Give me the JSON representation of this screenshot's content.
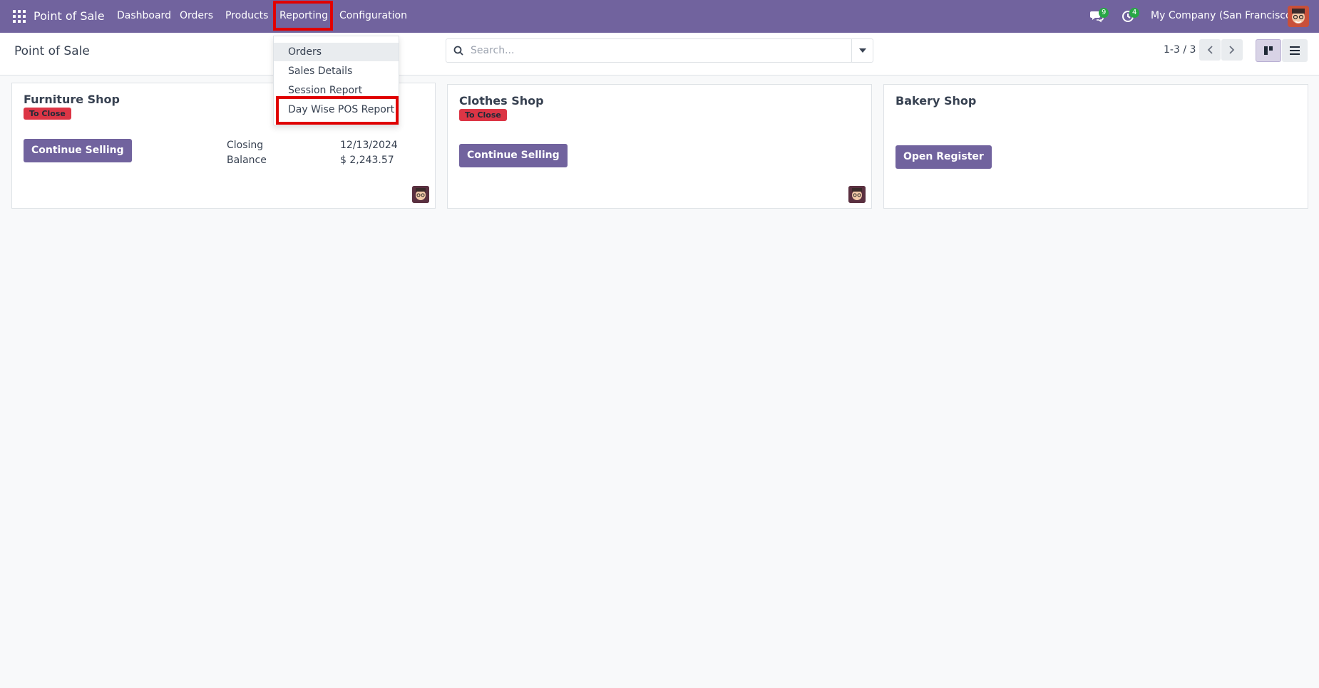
{
  "navbar": {
    "brand": "Point of Sale",
    "menu": [
      "Dashboard",
      "Orders",
      "Products",
      "Reporting",
      "Configuration"
    ],
    "messages_count": "9",
    "activities_count": "4",
    "company": "My Company (San Francisco)"
  },
  "reporting_menu": {
    "items": [
      "Orders",
      "Sales Details",
      "Session Report",
      "Day Wise POS Report"
    ]
  },
  "control_panel": {
    "title": "Point of Sale",
    "search_placeholder": "Search...",
    "pager": "1-3 / 3"
  },
  "cards": [
    {
      "name": "Furniture Shop",
      "status": "To Close",
      "button": "Continue Selling",
      "closing_label": "Closing",
      "closing_value": "12/13/2024",
      "balance_label": "Balance",
      "balance_value": "$ 2,243.57"
    },
    {
      "name": "Clothes Shop",
      "status": "To Close",
      "button": "Continue Selling"
    },
    {
      "name": "Bakery Shop",
      "button": "Open Register"
    }
  ],
  "colors": {
    "navbar": "#71639e",
    "primary": "#71639e",
    "status_badge": "#dc3545",
    "highlight": "#e00000"
  }
}
